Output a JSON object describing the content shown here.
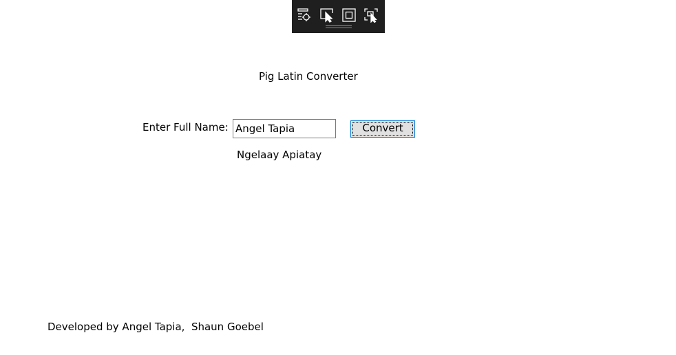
{
  "debug_toolbar": {
    "buttons": [
      {
        "icon": "live-visual-tree-icon"
      },
      {
        "icon": "select-element-icon"
      },
      {
        "icon": "display-layout-adorners-icon"
      },
      {
        "icon": "track-focus-icon"
      }
    ]
  },
  "app": {
    "title": "Pig Latin Converter"
  },
  "form": {
    "name_label": "Enter Full Name:",
    "name_value": "Angel Tapia",
    "convert_label": "Convert",
    "result": "Ngelaay Apiatay"
  },
  "footer": {
    "credits": "Developed by Angel Tapia,  Shaun Goebel"
  }
}
